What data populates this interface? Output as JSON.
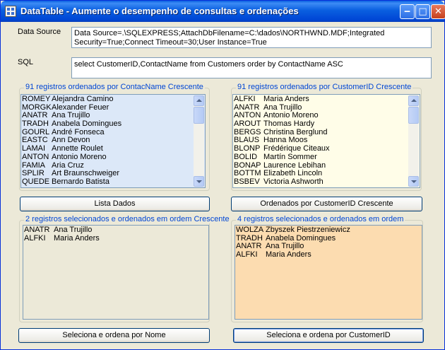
{
  "window": {
    "title": "DataTable - Aumente o desempenho de consultas e ordenações"
  },
  "form": {
    "data_source_label": "Data Source",
    "data_source_value": "Data Source=.\\SQLEXPRESS;AttachDbFilename=C:\\dados\\NORTHWND.MDF;Integrated Security=True;Connect Timeout=30;User Instance=True",
    "sql_label": "SQL",
    "sql_value": "select CustomerID,ContactName from Customers order by ContactName ASC"
  },
  "group_by_name": {
    "title": "91 registros ordenados por ContacName Crescente",
    "background": "#dce8f8",
    "items": [
      {
        "id": "ROMEY",
        "name": "Alejandra Camino"
      },
      {
        "id": "MORGK",
        "name": "Alexander Feuer"
      },
      {
        "id": "ANATR",
        "name": "Ana Trujillo"
      },
      {
        "id": "TRADH",
        "name": "Anabela Domingues"
      },
      {
        "id": "GOURL",
        "name": "André Fonseca"
      },
      {
        "id": "EASTC",
        "name": "Ann Devon"
      },
      {
        "id": "LAMAI",
        "name": "Annette Roulet"
      },
      {
        "id": "ANTON",
        "name": "Antonio Moreno"
      },
      {
        "id": "FAMIA",
        "name": "Aria Cruz"
      },
      {
        "id": "SPLIR",
        "name": "Art Braunschweiger"
      },
      {
        "id": "QUEDE",
        "name": "Bernardo Batista"
      }
    ]
  },
  "group_by_id": {
    "title": "91 registros ordenados por CustomerID Crescente",
    "background": "#fffde8",
    "items": [
      {
        "id": "ALFKI",
        "name": "Maria Anders"
      },
      {
        "id": "ANATR",
        "name": "Ana Trujillo"
      },
      {
        "id": "ANTON",
        "name": "Antonio Moreno"
      },
      {
        "id": "AROUT",
        "name": "Thomas Hardy"
      },
      {
        "id": "BERGS",
        "name": "Christina Berglund"
      },
      {
        "id": "BLAUS",
        "name": "Hanna Moos"
      },
      {
        "id": "BLONP",
        "name": "Frédérique Citeaux"
      },
      {
        "id": "BOLID",
        "name": "Martín Sommer"
      },
      {
        "id": "BONAP",
        "name": "Laurence Lebihan"
      },
      {
        "id": "BOTTM",
        "name": "Elizabeth Lincoln"
      },
      {
        "id": "BSBEV",
        "name": "Victoria Ashworth"
      }
    ]
  },
  "buttons": {
    "lista_dados": "Lista Dados",
    "ordenados_customerid": "Ordenados por CustomerID Crescente",
    "seleciona_nome": "Seleciona e ordena por Nome",
    "seleciona_customerid": "Seleciona e ordena por CustomerID"
  },
  "group_selected_asc": {
    "title": "2 registros selecionados e ordenados em ordem Crescente",
    "background": "#ece9d8",
    "items": [
      {
        "id": "ANATR",
        "name": "Ana Trujillo"
      },
      {
        "id": "ALFKI",
        "name": "Maria Anders"
      }
    ]
  },
  "group_selected_order": {
    "title": "4 registros selecionados e ordenados em ordem",
    "background": "#fcdcb0",
    "items": [
      {
        "id": "WOLZA",
        "name": "Zbyszek Piestrzeniewicz"
      },
      {
        "id": "TRADH",
        "name": "Anabela Domingues"
      },
      {
        "id": "ANATR",
        "name": "Ana Trujillo"
      },
      {
        "id": "ALFKI",
        "name": "Maria Anders"
      }
    ]
  }
}
